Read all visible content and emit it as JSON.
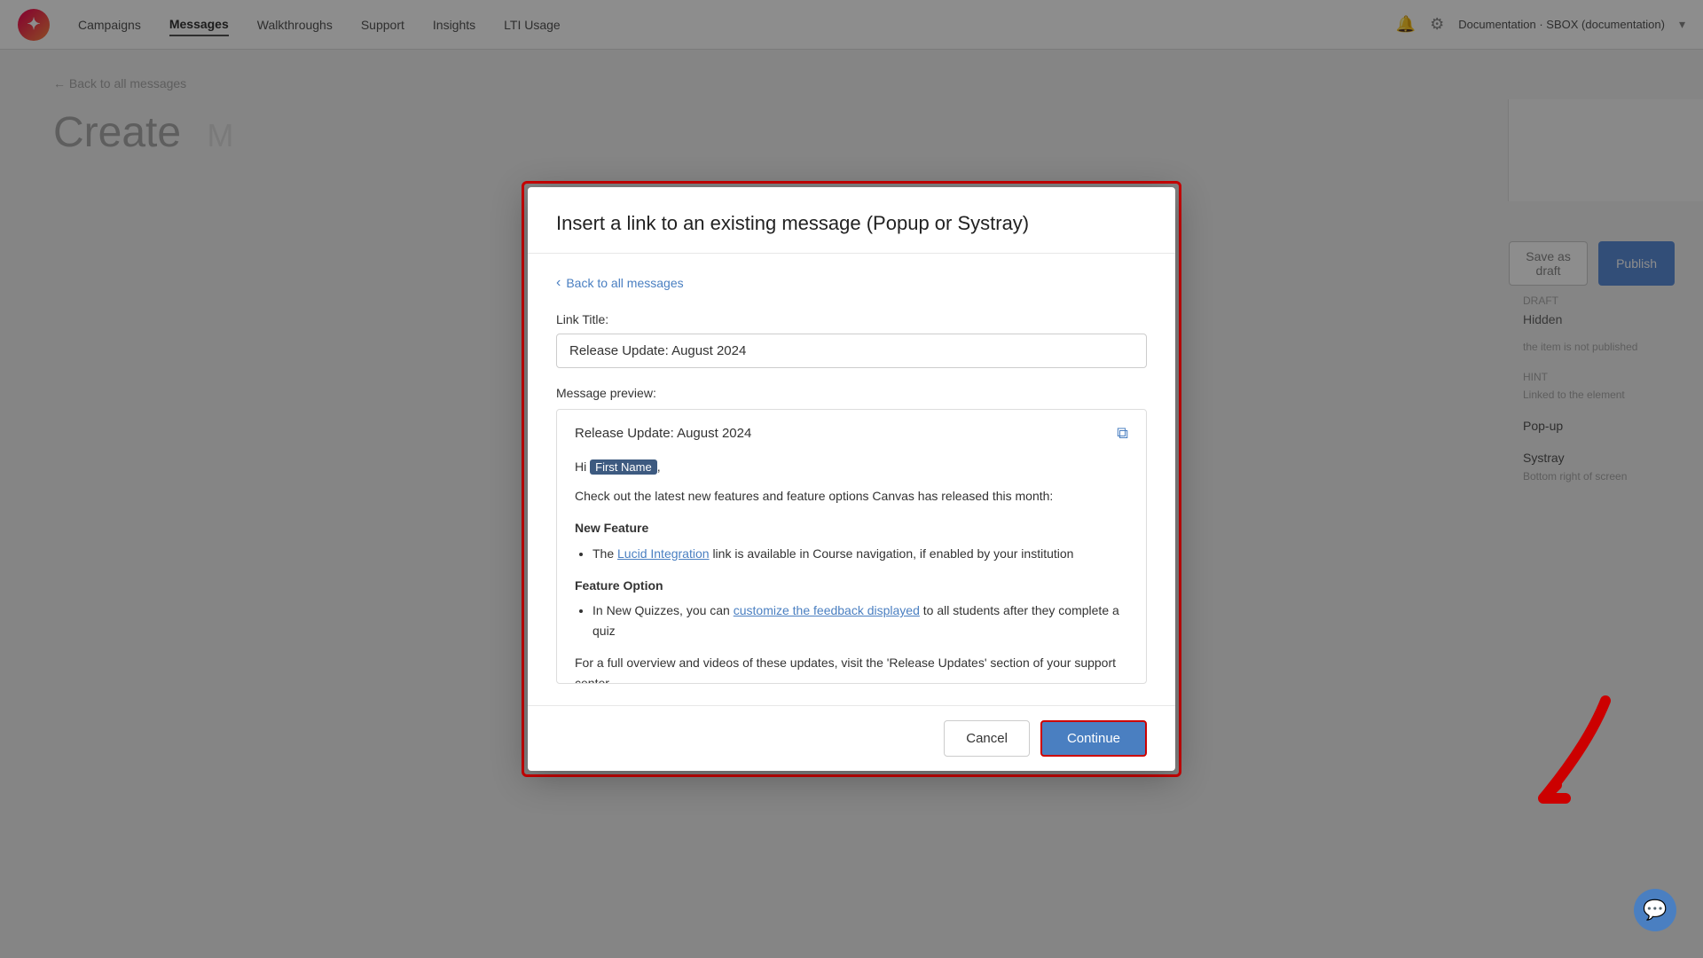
{
  "nav": {
    "logo": "✦",
    "items": [
      {
        "label": "Campaigns",
        "active": false
      },
      {
        "label": "Messages",
        "active": true
      },
      {
        "label": "Walkthroughs",
        "active": false
      },
      {
        "label": "Support",
        "active": false
      },
      {
        "label": "Insights",
        "active": false
      },
      {
        "label": "LTI Usage",
        "active": false
      }
    ],
    "org": "Documentation · SBOX (documentation)",
    "dropdown_icon": "▾"
  },
  "page": {
    "title": "Create",
    "back_link": "← Back to all messages",
    "save_draft_label": "Save as draft",
    "publish_label": "Publish"
  },
  "right_panel": {
    "status_label": "Draft",
    "hidden_label": "Hidden",
    "hidden_desc": "the item is not published",
    "hint_label": "Hint",
    "hint_desc": "Linked to the element",
    "popup_label": "Pop-up",
    "systray_label": "Systray",
    "systray_desc": "Bottom right of screen"
  },
  "modal": {
    "title": "Insert a link to an existing message (Popup or Systray)",
    "back_label": "Back to all messages",
    "link_title_label": "Link Title:",
    "link_title_value": "Release Update: August 2024",
    "preview_label": "Message preview:",
    "preview": {
      "title": "Release Update: August 2024",
      "greeting": "Hi",
      "first_name_badge": "First Name",
      "intro": "Check out the latest new features and feature options Canvas has released this month:",
      "section1_title": "New Feature",
      "section1_item": "The",
      "section1_link": "Lucid Integration",
      "section1_item_after": "link is available in Course navigation, if enabled by your institution",
      "section2_title": "Feature Option",
      "section2_item_before": "In New Quizzes, you can",
      "section2_link": "customize the feedback displayed",
      "section2_item_after": "to all students after they complete a quiz",
      "footer": "For a full overview and videos of these updates, visit the 'Release Updates' section of your support center."
    },
    "cancel_label": "Cancel",
    "continue_label": "Continue"
  },
  "chat": {
    "icon": "💬"
  }
}
